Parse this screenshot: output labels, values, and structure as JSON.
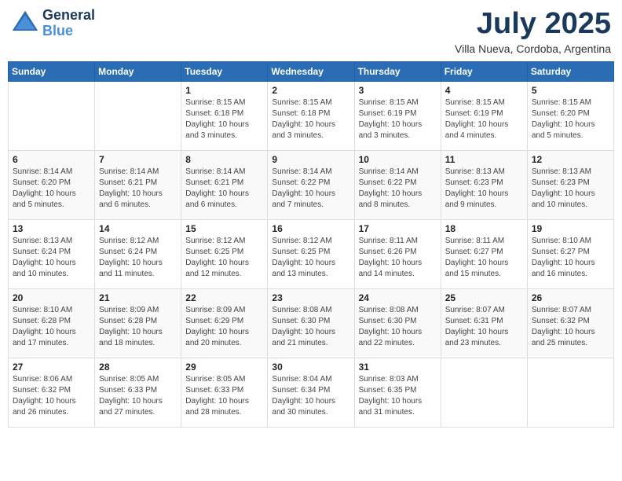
{
  "header": {
    "logo_line1": "General",
    "logo_line2": "Blue",
    "month": "July 2025",
    "location": "Villa Nueva, Cordoba, Argentina"
  },
  "weekdays": [
    "Sunday",
    "Monday",
    "Tuesday",
    "Wednesday",
    "Thursday",
    "Friday",
    "Saturday"
  ],
  "weeks": [
    [
      {
        "day": "",
        "info": ""
      },
      {
        "day": "",
        "info": ""
      },
      {
        "day": "1",
        "info": "Sunrise: 8:15 AM\nSunset: 6:18 PM\nDaylight: 10 hours and 3 minutes."
      },
      {
        "day": "2",
        "info": "Sunrise: 8:15 AM\nSunset: 6:18 PM\nDaylight: 10 hours and 3 minutes."
      },
      {
        "day": "3",
        "info": "Sunrise: 8:15 AM\nSunset: 6:19 PM\nDaylight: 10 hours and 3 minutes."
      },
      {
        "day": "4",
        "info": "Sunrise: 8:15 AM\nSunset: 6:19 PM\nDaylight: 10 hours and 4 minutes."
      },
      {
        "day": "5",
        "info": "Sunrise: 8:15 AM\nSunset: 6:20 PM\nDaylight: 10 hours and 5 minutes."
      }
    ],
    [
      {
        "day": "6",
        "info": "Sunrise: 8:14 AM\nSunset: 6:20 PM\nDaylight: 10 hours and 5 minutes."
      },
      {
        "day": "7",
        "info": "Sunrise: 8:14 AM\nSunset: 6:21 PM\nDaylight: 10 hours and 6 minutes."
      },
      {
        "day": "8",
        "info": "Sunrise: 8:14 AM\nSunset: 6:21 PM\nDaylight: 10 hours and 6 minutes."
      },
      {
        "day": "9",
        "info": "Sunrise: 8:14 AM\nSunset: 6:22 PM\nDaylight: 10 hours and 7 minutes."
      },
      {
        "day": "10",
        "info": "Sunrise: 8:14 AM\nSunset: 6:22 PM\nDaylight: 10 hours and 8 minutes."
      },
      {
        "day": "11",
        "info": "Sunrise: 8:13 AM\nSunset: 6:23 PM\nDaylight: 10 hours and 9 minutes."
      },
      {
        "day": "12",
        "info": "Sunrise: 8:13 AM\nSunset: 6:23 PM\nDaylight: 10 hours and 10 minutes."
      }
    ],
    [
      {
        "day": "13",
        "info": "Sunrise: 8:13 AM\nSunset: 6:24 PM\nDaylight: 10 hours and 10 minutes."
      },
      {
        "day": "14",
        "info": "Sunrise: 8:12 AM\nSunset: 6:24 PM\nDaylight: 10 hours and 11 minutes."
      },
      {
        "day": "15",
        "info": "Sunrise: 8:12 AM\nSunset: 6:25 PM\nDaylight: 10 hours and 12 minutes."
      },
      {
        "day": "16",
        "info": "Sunrise: 8:12 AM\nSunset: 6:25 PM\nDaylight: 10 hours and 13 minutes."
      },
      {
        "day": "17",
        "info": "Sunrise: 8:11 AM\nSunset: 6:26 PM\nDaylight: 10 hours and 14 minutes."
      },
      {
        "day": "18",
        "info": "Sunrise: 8:11 AM\nSunset: 6:27 PM\nDaylight: 10 hours and 15 minutes."
      },
      {
        "day": "19",
        "info": "Sunrise: 8:10 AM\nSunset: 6:27 PM\nDaylight: 10 hours and 16 minutes."
      }
    ],
    [
      {
        "day": "20",
        "info": "Sunrise: 8:10 AM\nSunset: 6:28 PM\nDaylight: 10 hours and 17 minutes."
      },
      {
        "day": "21",
        "info": "Sunrise: 8:09 AM\nSunset: 6:28 PM\nDaylight: 10 hours and 18 minutes."
      },
      {
        "day": "22",
        "info": "Sunrise: 8:09 AM\nSunset: 6:29 PM\nDaylight: 10 hours and 20 minutes."
      },
      {
        "day": "23",
        "info": "Sunrise: 8:08 AM\nSunset: 6:30 PM\nDaylight: 10 hours and 21 minutes."
      },
      {
        "day": "24",
        "info": "Sunrise: 8:08 AM\nSunset: 6:30 PM\nDaylight: 10 hours and 22 minutes."
      },
      {
        "day": "25",
        "info": "Sunrise: 8:07 AM\nSunset: 6:31 PM\nDaylight: 10 hours and 23 minutes."
      },
      {
        "day": "26",
        "info": "Sunrise: 8:07 AM\nSunset: 6:32 PM\nDaylight: 10 hours and 25 minutes."
      }
    ],
    [
      {
        "day": "27",
        "info": "Sunrise: 8:06 AM\nSunset: 6:32 PM\nDaylight: 10 hours and 26 minutes."
      },
      {
        "day": "28",
        "info": "Sunrise: 8:05 AM\nSunset: 6:33 PM\nDaylight: 10 hours and 27 minutes."
      },
      {
        "day": "29",
        "info": "Sunrise: 8:05 AM\nSunset: 6:33 PM\nDaylight: 10 hours and 28 minutes."
      },
      {
        "day": "30",
        "info": "Sunrise: 8:04 AM\nSunset: 6:34 PM\nDaylight: 10 hours and 30 minutes."
      },
      {
        "day": "31",
        "info": "Sunrise: 8:03 AM\nSunset: 6:35 PM\nDaylight: 10 hours and 31 minutes."
      },
      {
        "day": "",
        "info": ""
      },
      {
        "day": "",
        "info": ""
      }
    ]
  ]
}
